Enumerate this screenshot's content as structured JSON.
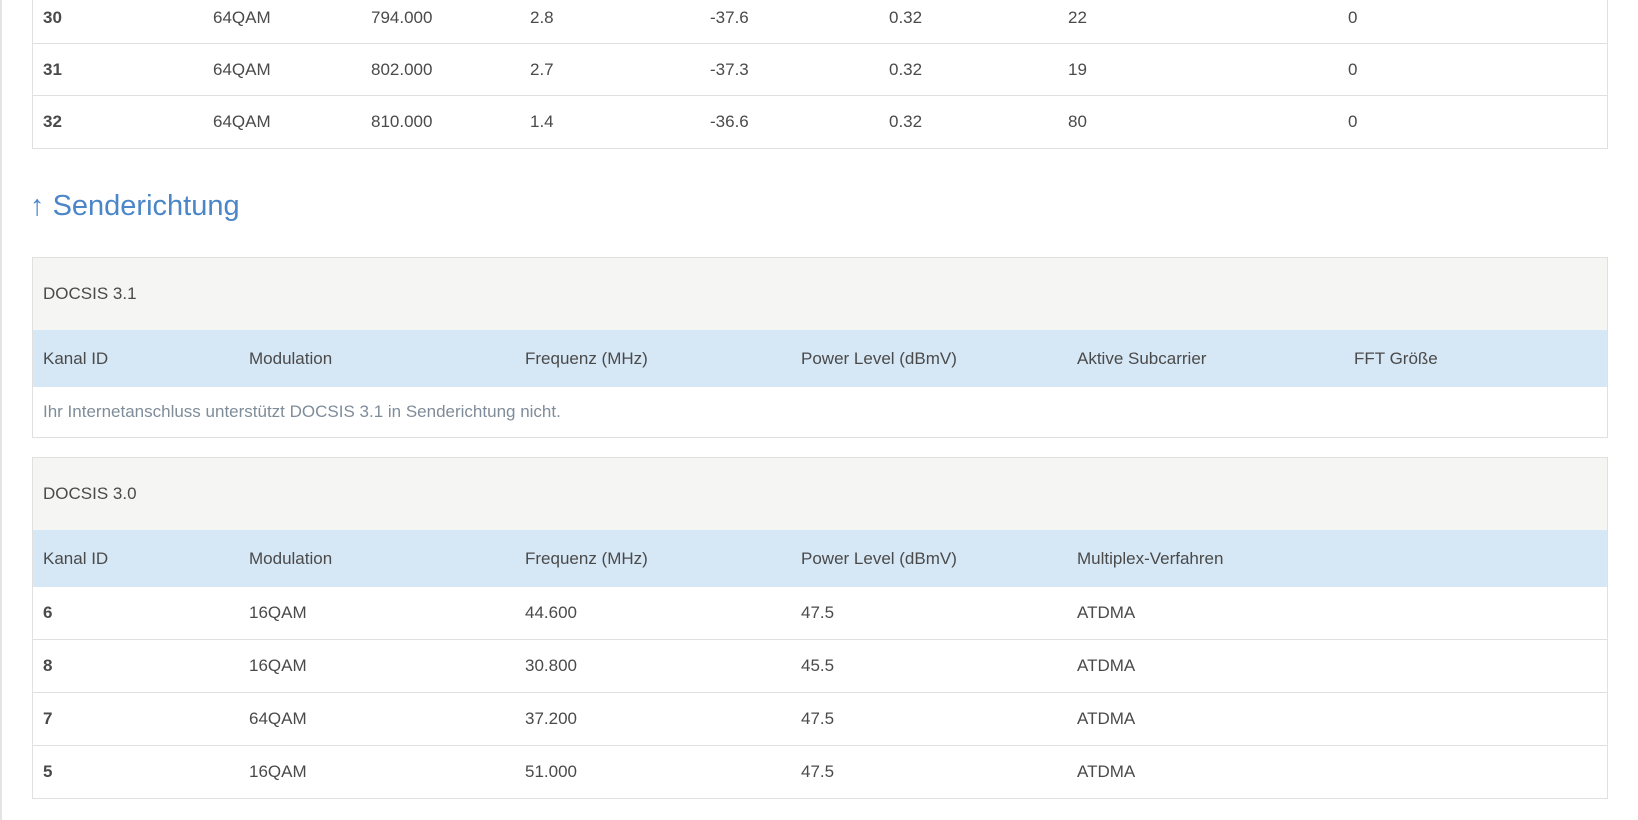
{
  "downstream_rows": [
    [
      "30",
      "64QAM",
      "794.000",
      "2.8",
      "-37.6",
      "0.32",
      "22",
      "0"
    ],
    [
      "31",
      "64QAM",
      "802.000",
      "2.7",
      "-37.3",
      "0.32",
      "19",
      "0"
    ],
    [
      "32",
      "64QAM",
      "810.000",
      "1.4",
      "-36.6",
      "0.32",
      "80",
      "0"
    ]
  ],
  "upstream": {
    "heading_arrow": "↑",
    "heading": "Senderichtung",
    "docsis31": {
      "title": "DOCSIS 3.1",
      "columns": [
        "Kanal ID",
        "Modulation",
        "Frequenz (MHz)",
        "Power Level (dBmV)",
        "Aktive Subcarrier",
        "FFT Größe"
      ],
      "message": "Ihr Internetanschluss unterstützt DOCSIS 3.1 in Senderichtung nicht."
    },
    "docsis30": {
      "title": "DOCSIS 3.0",
      "columns": [
        "Kanal ID",
        "Modulation",
        "Frequenz (MHz)",
        "Power Level (dBmV)",
        "Multiplex-Verfahren"
      ],
      "rows": [
        [
          "6",
          "16QAM",
          "44.600",
          "47.5",
          "ATDMA"
        ],
        [
          "8",
          "16QAM",
          "30.800",
          "45.5",
          "ATDMA"
        ],
        [
          "7",
          "64QAM",
          "37.200",
          "47.5",
          "ATDMA"
        ],
        [
          "5",
          "16QAM",
          "51.000",
          "47.5",
          "ATDMA"
        ]
      ]
    }
  }
}
